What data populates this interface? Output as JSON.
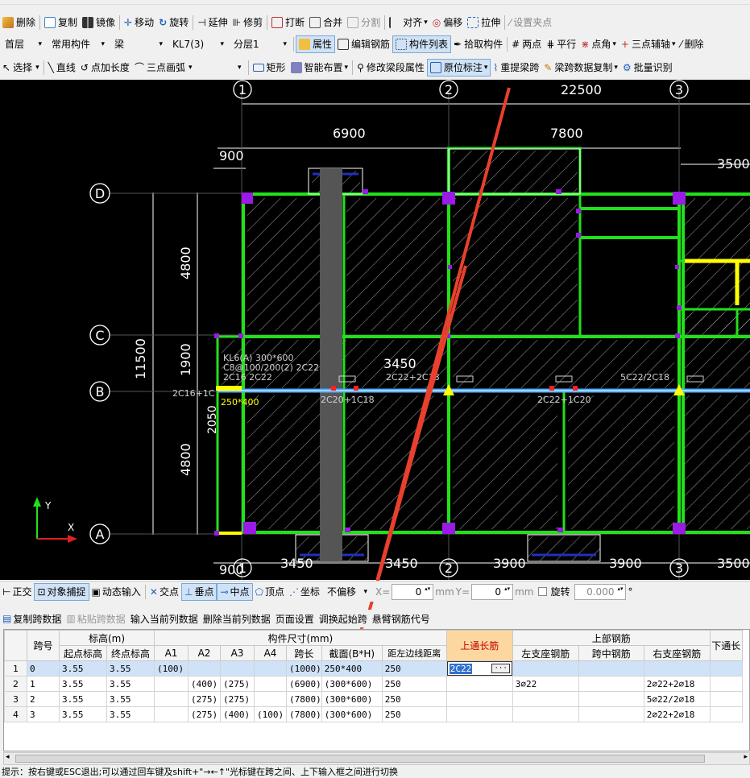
{
  "toolbar1": {
    "partial_top": "...",
    "delete": "删除",
    "copy": "复制",
    "mirror": "镜像",
    "move": "移动",
    "rotate": "旋转",
    "extend": "延伸",
    "trim": "修剪",
    "break": "打断",
    "merge": "合并",
    "split": "分割",
    "align": "对齐",
    "offset": "偏移",
    "stretch": "拉伸",
    "set_grip": "设置夹点"
  },
  "toolbar2": {
    "floor": "首层",
    "component_type": "常用构件",
    "component_subtype": "梁",
    "component_name": "KL7(3)",
    "sublayer": "分层1",
    "properties": "属性",
    "edit_rebar": "编辑钢筋",
    "component_list": "构件列表",
    "pick_component": "拾取构件",
    "two_points": "两点",
    "parallel": "平行",
    "point_angle": "点角",
    "three_point_aux": "三点辅轴",
    "delete_aux": "删除"
  },
  "toolbar3": {
    "select": "选择",
    "line": "直线",
    "point_length": "点加长度",
    "three_point_arc": "三点画弧",
    "rectangle": "矩形",
    "smart_layout": "智能布置",
    "modify_span_props": "修改梁段属性",
    "in_place_annotation": "原位标注",
    "re_extract_span": "重提梁跨",
    "copy_span_data": "梁跨数据复制",
    "batch_identify": "批量识别"
  },
  "drawing": {
    "axis_numbers": [
      "1",
      "2",
      "3"
    ],
    "axis_letters": [
      "D",
      "C",
      "B",
      "A"
    ],
    "dim_top_total": "22500",
    "dim_6900": "6900",
    "dim_7800": "7800",
    "dim_900": "900",
    "dim_3500": "3500",
    "dim_4800_top": "4800",
    "dim_1900": "1900",
    "dim_11500": "11500",
    "dim_4800_bottom": "4800",
    "dim_2050": "2050",
    "dim_bottom_900": "900",
    "dim_bottom_3450a": "3450",
    "dim_bottom_3450b": "3450",
    "dim_bottom_3900a": "3900",
    "dim_bottom_3900b": "3900",
    "dim_bottom_3500": "3500",
    "beam_label_1": "KL6(A) 300*600",
    "beam_label_2": "C8@100/200(2) 2C22",
    "beam_label_3": "2C16 2C22",
    "beam_span_3450": "3450",
    "rebar_2c16": "2C16+1C",
    "rebar_250x400": "250*400",
    "rebar_2c20_1c18": "2C20+1C18",
    "rebar_2c22_2c18": "2C22+2C18",
    "rebar_2c22_1c20": "2C22+1C20",
    "rebar_5c22_2c18": "5C22/2C18",
    "axis_y": "Y",
    "axis_x": "X",
    "colors": {
      "beam": "#22e01a",
      "selected_beam": "#4aa8ff",
      "column": "#9a1ae6",
      "dim": "#ffffff",
      "yellow": "#ffff00",
      "red_arrow": "#e8402c",
      "gray_beam": "#555555"
    }
  },
  "status": {
    "ortho": "正交",
    "osnap": "对象捕捉",
    "dynamic_input": "动态输入",
    "intersection": "交点",
    "perpendicular": "垂点",
    "midpoint": "中点",
    "vertex": "顶点",
    "coordinate": "坐标",
    "offset_mode": "不偏移",
    "x_label": "X=",
    "x_value": "0",
    "y_label": "Y=",
    "y_value": "0",
    "unit": "mm",
    "rotate": "旋转",
    "rotate_value": "0.000",
    "degree": "°"
  },
  "grid_toolbar": {
    "copy_span": "复制跨数据",
    "paste_span": "粘贴跨数据",
    "input_column": "输入当前列数据",
    "delete_column": "删除当前列数据",
    "page_setup": "页面设置",
    "swap_start": "调换起始跨",
    "cantilever_code": "悬臂钢筋代号"
  },
  "grid": {
    "group_headers": {
      "elevation": "标高(m)",
      "dimension": "构件尺寸(mm)",
      "top_rebar": "上部钢筋"
    },
    "columns": {
      "span_no": "跨号",
      "start_elev": "起点标高",
      "end_elev": "终点标高",
      "a1": "A1",
      "a2": "A2",
      "a3": "A3",
      "a4": "A4",
      "span_length": "跨长",
      "section": "截面(B*H)",
      "dist_left_line": "距左边线距离",
      "top_through": "上通长筋",
      "left_support": "左支座钢筋",
      "mid_span": "跨中钢筋",
      "right_support": "右支座钢筋",
      "bottom_through": "下通长"
    },
    "rows": [
      {
        "rn": "1",
        "span": "0",
        "start": "3.55",
        "end": "3.55",
        "a1": "(100)",
        "a2": "",
        "a3": "",
        "a4": "",
        "len": "(1000)",
        "sec": "250*400",
        "dist": "250",
        "top": "2C22",
        "left": "",
        "mid": "",
        "right": "",
        "bot": ""
      },
      {
        "rn": "2",
        "span": "1",
        "start": "3.55",
        "end": "3.55",
        "a1": "",
        "a2": "(400)",
        "a3": "(275)",
        "a4": "",
        "len": "(6900)",
        "sec": "(300*600)",
        "dist": "250",
        "top": "",
        "left": "3⌀22",
        "mid": "",
        "right": "2⌀22+2⌀18",
        "bot": ""
      },
      {
        "rn": "3",
        "span": "2",
        "start": "3.55",
        "end": "3.55",
        "a1": "",
        "a2": "(275)",
        "a3": "(275)",
        "a4": "",
        "len": "(7800)",
        "sec": "(300*600)",
        "dist": "250",
        "top": "",
        "left": "",
        "mid": "",
        "right": "5⌀22/2⌀18",
        "bot": ""
      },
      {
        "rn": "4",
        "span": "3",
        "start": "3.55",
        "end": "3.55",
        "a1": "",
        "a2": "(275)",
        "a3": "(400)",
        "a4": "(100)",
        "len": "(7800)",
        "sec": "(300*600)",
        "dist": "250",
        "top": "",
        "left": "",
        "mid": "",
        "right": "2⌀22+2⌀18",
        "bot": ""
      }
    ]
  },
  "bottom_hint": "提示：按右键或ESC退出;可以通过回车键及shift+\"→←↑\"光标键在跨之间、上下输入框之间进行切换"
}
